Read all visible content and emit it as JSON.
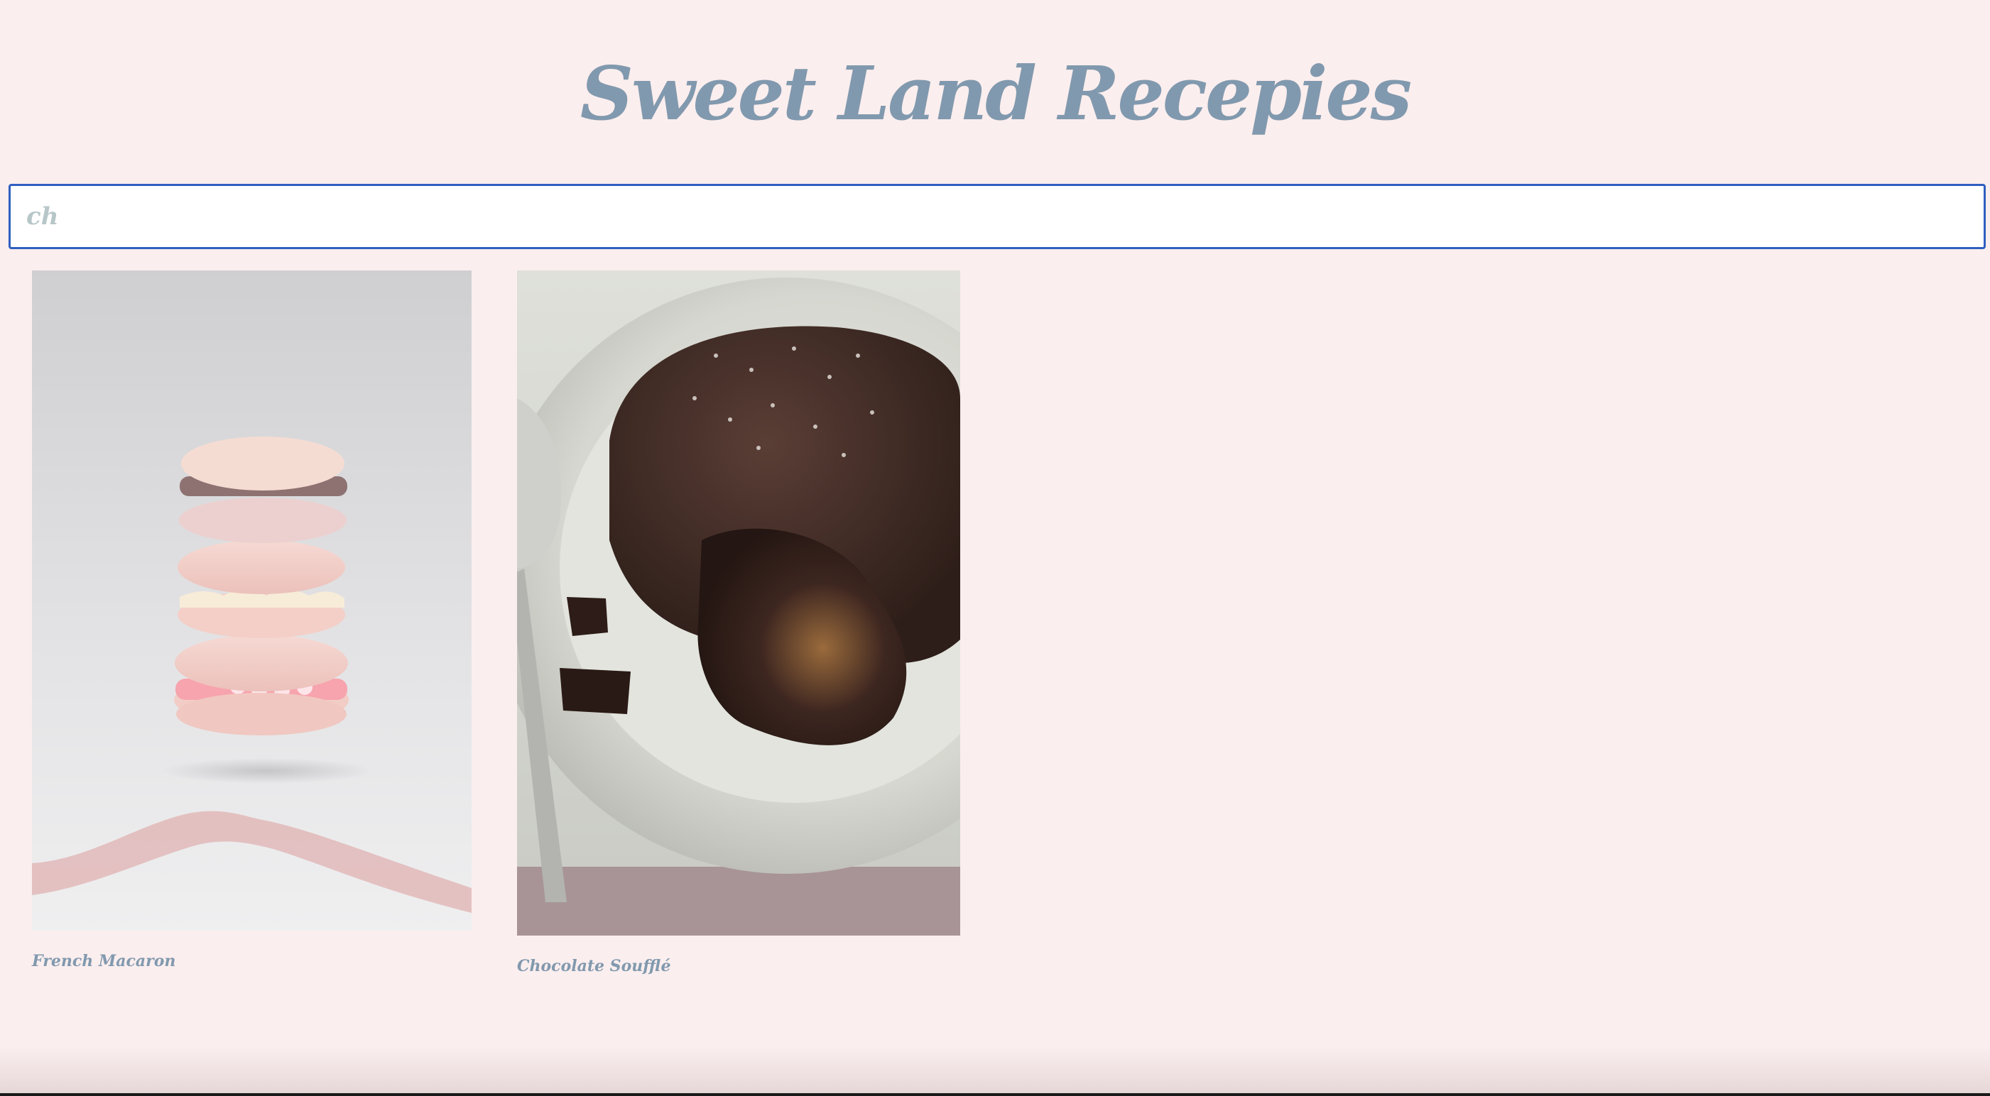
{
  "header": {
    "title": "Sweet Land Recepies"
  },
  "search": {
    "value": "ch",
    "placeholder": ""
  },
  "recipes": [
    {
      "name": "French Macaron",
      "image": "macaron-stack-image"
    },
    {
      "name": "Chocolate Soufflé",
      "image": "chocolate-lava-cake-image"
    }
  ],
  "colors": {
    "background": "#fbeeee",
    "title": "#8199ae",
    "search_border": "#2f5fbf",
    "search_text": "#b7c7c9"
  }
}
